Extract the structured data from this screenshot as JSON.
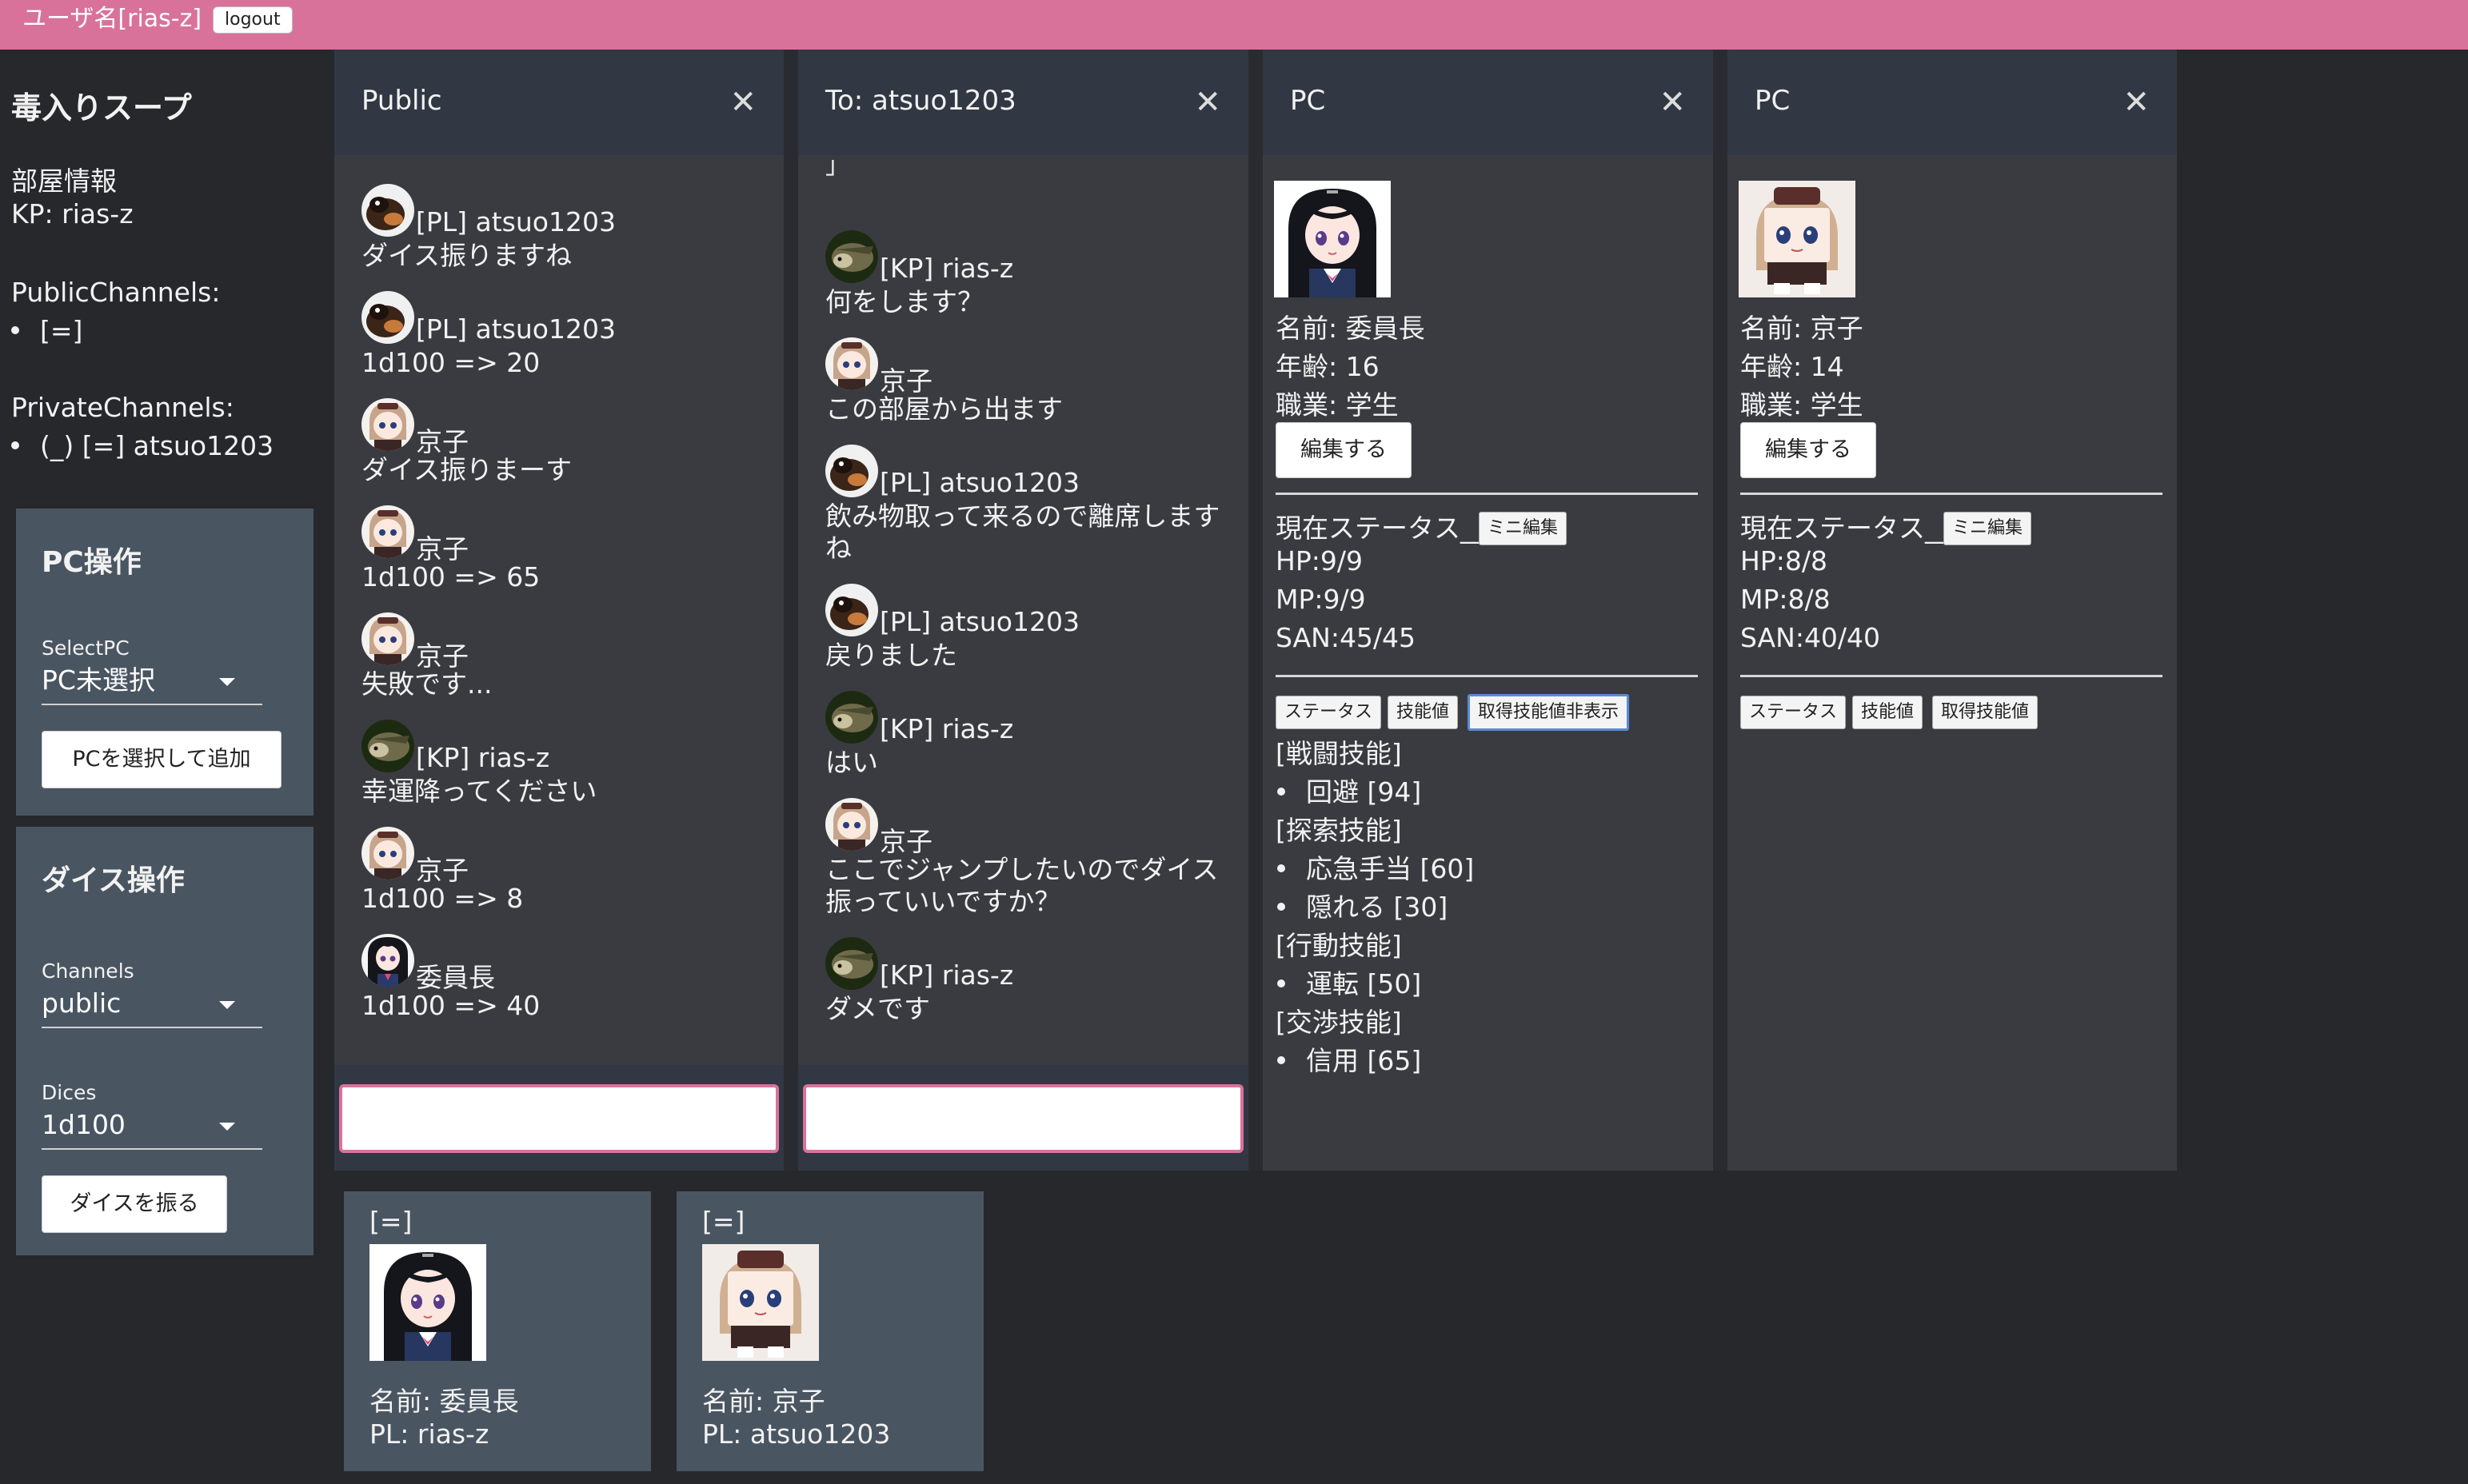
{
  "topbar": {
    "user_label": "ユーザ名[rias-z]",
    "logout_label": "logout",
    "color": "#d9729a"
  },
  "sidebar": {
    "room_title": "毒入りスープ",
    "room_info_heading": "部屋情報",
    "kp": "KP: rias-z",
    "public_channels_heading": "PublicChannels:",
    "public_channels": [
      "[=]"
    ],
    "private_channels_heading": "PrivateChannels:",
    "private_channels": [
      "(_) [=] atsuo1203"
    ]
  },
  "pc_panel": {
    "title": "PC操作",
    "select_label": "SelectPC",
    "select_value": "PC未選択",
    "add_button": "PCを選択して追加"
  },
  "dice_panel": {
    "title": "ダイス操作",
    "channels_label": "Channels",
    "channels_value": "public",
    "dices_label": "Dices",
    "dices_value": "1d100",
    "roll_button": "ダイスを振る"
  },
  "public_column": {
    "title": "Public",
    "messages": [
      {
        "who": "[PL] atsuo1203",
        "text": "ダイス振りますね",
        "avatar": "dog"
      },
      {
        "who": "[PL] atsuo1203",
        "text": "1d100 => 20",
        "avatar": "dog"
      },
      {
        "who": "京子",
        "text": "ダイス振りまーす",
        "avatar": "kyoko"
      },
      {
        "who": "京子",
        "text": "1d100 => 65",
        "avatar": "kyoko"
      },
      {
        "who": "京子",
        "text": "失敗です...",
        "avatar": "kyoko"
      },
      {
        "who": "[KP] rias-z",
        "text": "幸運降ってください",
        "avatar": "hedgehog"
      },
      {
        "who": "京子",
        "text": "1d100 => 8",
        "avatar": "kyoko"
      },
      {
        "who": "委員長",
        "text": "1d100 => 40",
        "avatar": "iinchou"
      }
    ]
  },
  "private_column": {
    "title": "To: atsuo1203",
    "partial_top": "」",
    "messages": [
      {
        "who": "[KP] rias-z",
        "text": "何をします？",
        "avatar": "hedgehog"
      },
      {
        "who": "京子",
        "text": "この部屋から出ます",
        "avatar": "kyoko"
      },
      {
        "who": "[PL] atsuo1203",
        "text_line1": "飲み物取って来るので離席します",
        "text_line2": "ね",
        "avatar": "dog"
      },
      {
        "who": "[PL] atsuo1203",
        "text": "戻りました",
        "avatar": "dog"
      },
      {
        "who": "[KP] rias-z",
        "text": "はい",
        "avatar": "hedgehog"
      },
      {
        "who": "京子",
        "text_line1": "ここでジャンプしたいのでダイス",
        "text_line2": "振っていいですか？",
        "avatar": "kyoko"
      },
      {
        "who": "[KP] rias-z",
        "text": "ダメです",
        "avatar": "hedgehog"
      }
    ]
  },
  "pc1": {
    "title": "PC",
    "name": "名前: 委員長",
    "age": "年齢: 16",
    "job": "職業: 学生",
    "edit_button": "編集する",
    "status_heading": "現在ステータス__",
    "mini_edit": "ミニ編集",
    "hp": "HP:9/9",
    "mp": "MP:9/9",
    "san": "SAN:45/45",
    "tabs": [
      "ステータス",
      "技能値",
      "取得技能値非表示"
    ],
    "skills": {
      "combat_heading": "[戦闘技能]",
      "combat": [
        "回避 [94]"
      ],
      "search_heading": "[探索技能]",
      "search": [
        "応急手当 [60]",
        "隠れる [30]"
      ],
      "action_heading": "[行動技能]",
      "action": [
        "運転 [50]"
      ],
      "negotiation_heading": "[交渉技能]",
      "negotiation": [
        "信用 [65]"
      ]
    }
  },
  "pc2": {
    "title": "PC",
    "name": "名前: 京子",
    "age": "年齢: 14",
    "job": "職業: 学生",
    "edit_button": "編集する",
    "status_heading": "現在ステータス__",
    "mini_edit": "ミニ編集",
    "hp": "HP:8/8",
    "mp": "MP:8/8",
    "san": "SAN:40/40",
    "tabs": [
      "ステータス",
      "技能値",
      "取得技能値"
    ]
  },
  "bottom_cards": [
    {
      "tag": "[=]",
      "name": "名前: 委員長",
      "pl": "PL: rias-z"
    },
    {
      "tag": "[=]",
      "name": "名前: 京子",
      "pl": "PL: atsuo1203"
    }
  ]
}
